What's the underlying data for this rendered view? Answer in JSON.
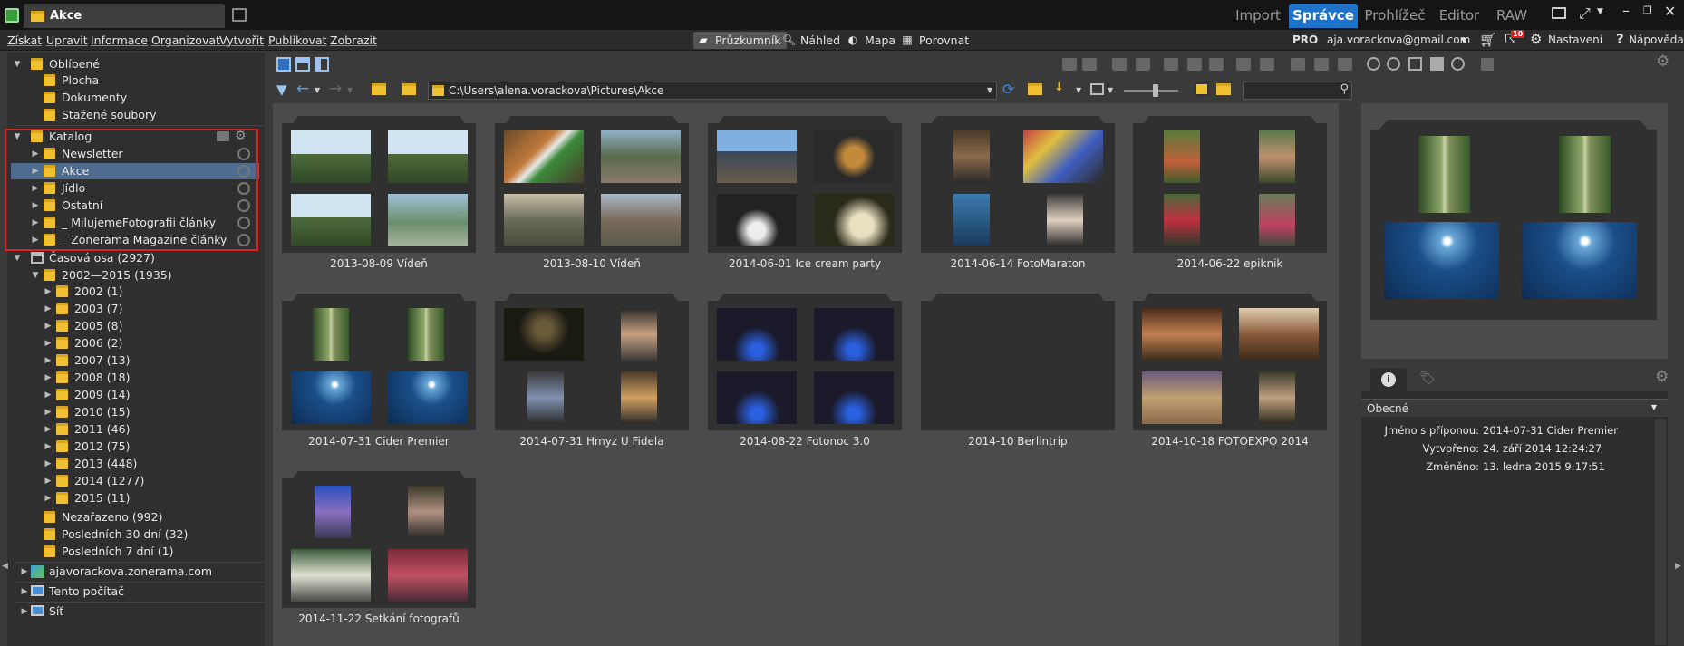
{
  "window": {
    "tab_title": "Akce"
  },
  "modes": [
    "Import",
    "Správce",
    "Prohlížeč",
    "Editor",
    "RAW"
  ],
  "active_mode": "Správce",
  "menu": [
    "Získat",
    "Upravit",
    "Informace",
    "Organizovat",
    "Vytvořit",
    "Publikovat",
    "Zobrazit"
  ],
  "views": [
    "Průzkumník",
    "Náhled",
    "Mapa",
    "Porovnat"
  ],
  "account": {
    "pro": "PRO",
    "email": "aja.vorackova@gmail.com",
    "cart_badge": "10",
    "settings": "Nastavení",
    "help": "Nápověda"
  },
  "tree": {
    "favorites": "Oblíbené",
    "fav_items": [
      "Plocha",
      "Dokumenty",
      "Stažené soubory"
    ],
    "catalog": "Katalog",
    "catalog_items": [
      "Newsletter",
      "Akce",
      "Jídlo",
      "Ostatní",
      "_ MilujemeFotografii články",
      "_ Zonerama Magazine články"
    ],
    "timeline": "Časová osa (2927)",
    "range": "2002—2015 (1935)",
    "years": [
      "2002 (1)",
      "2003 (7)",
      "2005 (8)",
      "2006 (2)",
      "2007 (13)",
      "2008 (18)",
      "2009 (14)",
      "2010 (15)",
      "2011 (46)",
      "2012 (75)",
      "2013 (448)",
      "2014 (1277)",
      "2015 (11)"
    ],
    "extra": [
      "Nezařazeno (992)",
      "Posledních 30 dní (32)",
      "Posledních 7 dní (1)"
    ],
    "online": "ajavorackova.zonerama.com",
    "computer": "Tento počítač",
    "network": "Síť"
  },
  "path": "C:\\Users\\alena.vorackova\\Pictures\\Akce",
  "folders": [
    "2013-08-09 Vídeň",
    "2013-08-10 Vídeň",
    "2014-06-01 Ice cream party",
    "2014-06-14 FotoMaraton",
    "2014-06-22 epiknik",
    "2014-07-31 Cider Premier",
    "2014-07-31 Hmyz U Fidela",
    "2014-08-22 Fotonoc 3.0",
    "2014-10 Berlintrip",
    "2014-10-18 FOTOEXPO 2014",
    "2014-11-22 Setkání fotografů"
  ],
  "info": {
    "section": "Obecné",
    "rows": [
      {
        "k": "Jméno s příponou:",
        "v": "2014-07-31 Cider Premier"
      },
      {
        "k": "Vytvořeno:",
        "v": "24. září 2014 12:24:27"
      },
      {
        "k": "Změněno:",
        "v": "13. ledna 2015 9:17:51"
      }
    ]
  },
  "colors": {
    "accent": "#1e73c9",
    "highlight": "#e0201e",
    "folder": "#f0c030"
  }
}
